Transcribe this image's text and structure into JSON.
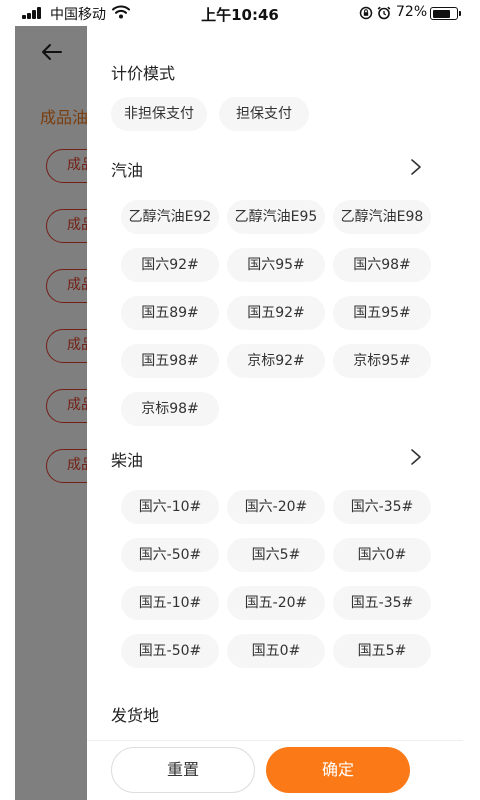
{
  "status_bar": {
    "carrier": "中国移动",
    "time": "上午10:46",
    "battery": "72%"
  },
  "background_page": {
    "category_label": "成品油",
    "chip_label": "成品"
  },
  "filter": {
    "pricing": {
      "title": "计价模式",
      "options": [
        "非担保支付",
        "担保支付"
      ]
    },
    "gasoline": {
      "title": "汽油",
      "options": [
        "乙醇汽油E92",
        "乙醇汽油E95",
        "乙醇汽油E98",
        "国六92#",
        "国六95#",
        "国六98#",
        "国五89#",
        "国五92#",
        "国五95#",
        "国五98#",
        "京标92#",
        "京标95#",
        "京标98#"
      ]
    },
    "diesel": {
      "title": "柴油",
      "options": [
        "国六-10#",
        "国六-20#",
        "国六-35#",
        "国六-50#",
        "国六5#",
        "国六0#",
        "国五-10#",
        "国五-20#",
        "国五-35#",
        "国五-50#",
        "国五0#",
        "国五5#"
      ]
    },
    "origin": {
      "title": "发货地"
    },
    "actions": {
      "reset_label": "重置",
      "confirm_label": "确定"
    }
  },
  "colors": {
    "accent": "#fb7a17",
    "chip_bg": "#f6f6f6",
    "bg_chip_border": "#e6432f",
    "bg_category": "#f47a1c"
  }
}
